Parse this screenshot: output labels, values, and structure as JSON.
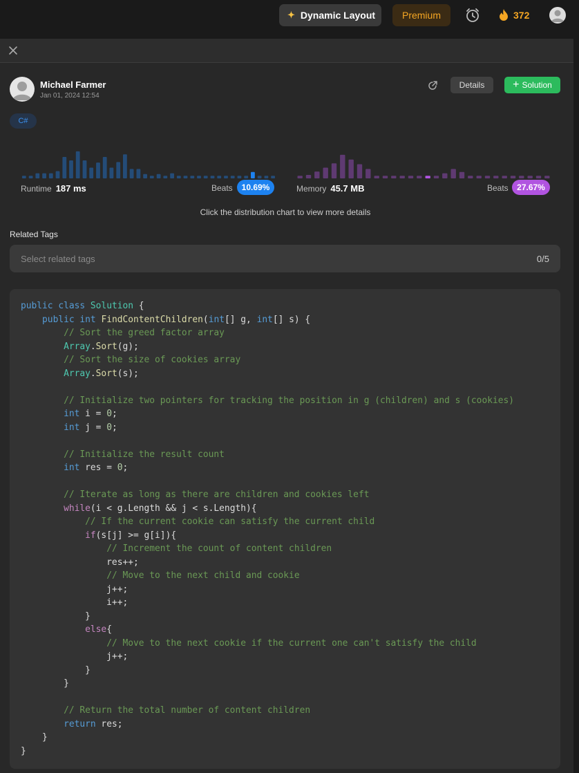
{
  "topbar": {
    "dynamic_layout_label": "Dynamic Layout",
    "premium_label": "Premium",
    "streak_count": "372",
    "icons": [
      "sparkle-icon",
      "alarm-clock-icon",
      "fire-icon",
      "user-avatar"
    ]
  },
  "author": {
    "name": "Michael Farmer",
    "date": "Jan 01, 2024 12:54"
  },
  "actions": {
    "details_label": "Details",
    "solution_label": "Solution"
  },
  "language_tag": "C#",
  "runtime": {
    "label": "Runtime",
    "value": "187 ms",
    "beats_label": "Beats",
    "beats_pct": "10.69%",
    "color": "#1d82f0",
    "distribution": [
      0.06,
      0.06,
      0.12,
      0.12,
      0.12,
      0.17,
      0.5,
      0.42,
      0.63,
      0.42,
      0.25,
      0.37,
      0.5,
      0.25,
      0.38,
      0.56,
      0.22,
      0.22,
      0.1,
      0.06,
      0.1,
      0.06,
      0.12,
      0.06,
      0.06,
      0.06,
      0.06,
      0.06,
      0.06,
      0.06,
      0.06,
      0.06,
      0.06,
      0.06,
      0.15,
      0.06,
      0.06,
      0.06
    ],
    "highlight_index": 34
  },
  "memory": {
    "label": "Memory",
    "value": "45.7 MB",
    "beats_label": "Beats",
    "beats_pct": "27.67%",
    "color": "#b154e0",
    "distribution": [
      0.06,
      0.08,
      0.16,
      0.25,
      0.35,
      0.55,
      0.44,
      0.33,
      0.22,
      0.06,
      0.06,
      0.06,
      0.06,
      0.06,
      0.06,
      0.06,
      0.06,
      0.12,
      0.22,
      0.15,
      0.06,
      0.06,
      0.06,
      0.06,
      0.06,
      0.06,
      0.06,
      0.06,
      0.06,
      0.06
    ],
    "highlight_index": 15
  },
  "chart_hint": "Click the distribution chart to view more details",
  "related_tags": {
    "label": "Related Tags",
    "placeholder": "Select related tags",
    "count": "0/5"
  },
  "code": "public class Solution {\n    public int FindContentChildren(int[] g, int[] s) {\n        // Sort the greed factor array\n        Array.Sort(g);\n        // Sort the size of cookies array\n        Array.Sort(s);\n\n        // Initialize two pointers for tracking the position in g (children) and s (cookies)\n        int i = 0;\n        int j = 0;\n\n        // Initialize the result count\n        int res = 0;\n\n        // Iterate as long as there are children and cookies left\n        while(i < g.Length && j < s.Length){\n            // If the current cookie can satisfy the current child\n            if(s[j] >= g[i]){\n                // Increment the count of content children\n                res++;\n                // Move to the next child and cookie\n                j++;\n                i++;\n            }\n            else{\n                // Move to the next cookie if the current one can't satisfy the child\n                j++;\n            }\n        }\n\n        // Return the total number of content children\n        return res;\n    }\n}"
}
